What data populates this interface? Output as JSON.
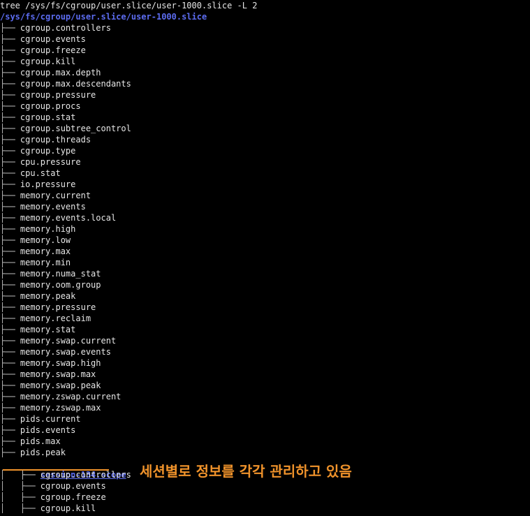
{
  "terminal": {
    "command": "tree /sys/fs/cgroup/user.slice/user-1000.slice -L 2",
    "root": "/sys/fs/cgroup/user.slice/user-1000.slice",
    "entries": [
      "cgroup.controllers",
      "cgroup.events",
      "cgroup.freeze",
      "cgroup.kill",
      "cgroup.max.depth",
      "cgroup.max.descendants",
      "cgroup.pressure",
      "cgroup.procs",
      "cgroup.stat",
      "cgroup.subtree_control",
      "cgroup.threads",
      "cgroup.type",
      "cpu.pressure",
      "cpu.stat",
      "io.pressure",
      "memory.current",
      "memory.events",
      "memory.events.local",
      "memory.high",
      "memory.low",
      "memory.max",
      "memory.min",
      "memory.numa_stat",
      "memory.oom.group",
      "memory.peak",
      "memory.pressure",
      "memory.reclaim",
      "memory.stat",
      "memory.swap.current",
      "memory.swap.events",
      "memory.swap.high",
      "memory.swap.max",
      "memory.swap.peak",
      "memory.zswap.current",
      "memory.zswap.max",
      "pids.current",
      "pids.events",
      "pids.max",
      "pids.peak"
    ],
    "scope_dir": "session-134.scope",
    "scope_entries": [
      "cgroup.controllers",
      "cgroup.events",
      "cgroup.freeze",
      "cgroup.kill"
    ]
  },
  "annotation": {
    "text": "세션별로 정보를 각각 관리하고 있음",
    "color": "#f0932b"
  }
}
